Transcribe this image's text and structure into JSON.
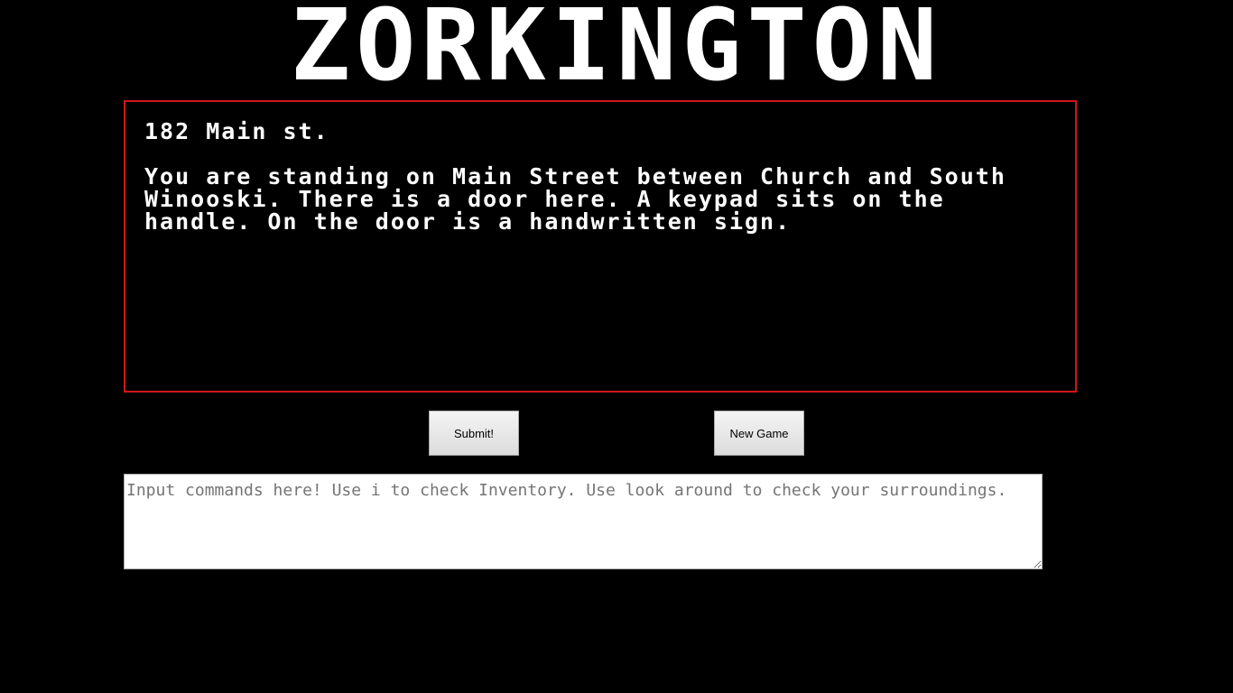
{
  "header": {
    "title": "ZORKINGTON"
  },
  "room": {
    "location": "182 Main st.",
    "description": "You are standing on Main Street between Church and South Winooski. There is a door here. A keypad sits on the handle. On the door is a handwritten sign."
  },
  "controls": {
    "submit_label": "Submit!",
    "new_game_label": "New Game"
  },
  "command": {
    "value": "",
    "placeholder": "Input commands here! Use i to check Inventory. Use look around to check your surroundings."
  },
  "colors": {
    "background": "#000000",
    "text": "#ffffff",
    "box_border": "#d0161a"
  }
}
